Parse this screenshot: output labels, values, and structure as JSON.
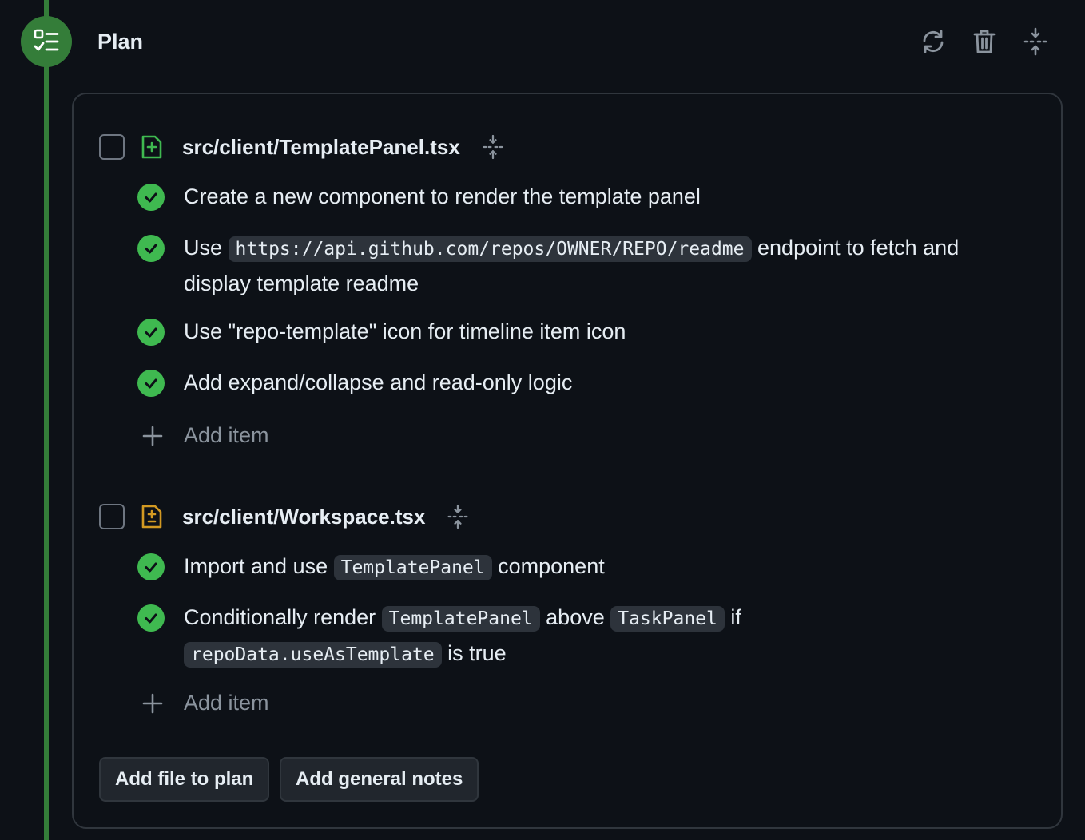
{
  "header": {
    "title": "Plan",
    "icons": [
      "plan-list-icon",
      "sync-icon",
      "trash-icon",
      "fold-icon"
    ]
  },
  "files": [
    {
      "name": "src/client/TemplatePanel.tsx",
      "status_icon": "file-added-icon",
      "status_color": "#3fb950",
      "items": [
        {
          "parts": [
            {
              "text": "Create a new component to render the template panel"
            }
          ]
        },
        {
          "parts": [
            {
              "text": "Use "
            },
            {
              "code": "https://api.github.com/repos/OWNER/REPO/readme"
            },
            {
              "text": " endpoint to fetch and display template readme"
            }
          ]
        },
        {
          "parts": [
            {
              "text": "Use \"repo-template\" icon for timeline item icon"
            }
          ]
        },
        {
          "parts": [
            {
              "text": "Add expand/collapse and read-only logic"
            }
          ]
        }
      ],
      "add_item_label": "Add item"
    },
    {
      "name": "src/client/Workspace.tsx",
      "status_icon": "file-modified-icon",
      "status_color": "#d29922",
      "items": [
        {
          "parts": [
            {
              "text": "Import and use "
            },
            {
              "code": "TemplatePanel"
            },
            {
              "text": " component"
            }
          ]
        },
        {
          "parts": [
            {
              "text": "Conditionally render "
            },
            {
              "code": "TemplatePanel"
            },
            {
              "text": " above "
            },
            {
              "code": "TaskPanel"
            },
            {
              "text": " if "
            },
            {
              "code": "repoData.useAsTemplate"
            },
            {
              "text": " is true"
            }
          ]
        }
      ],
      "add_item_label": "Add item"
    }
  ],
  "actions": {
    "add_file_label": "Add file to plan",
    "add_notes_label": "Add general notes"
  },
  "colors": {
    "accent_green": "#347d39",
    "check_green": "#3fb950",
    "modified_yellow": "#d29922",
    "background": "#0d1117"
  }
}
